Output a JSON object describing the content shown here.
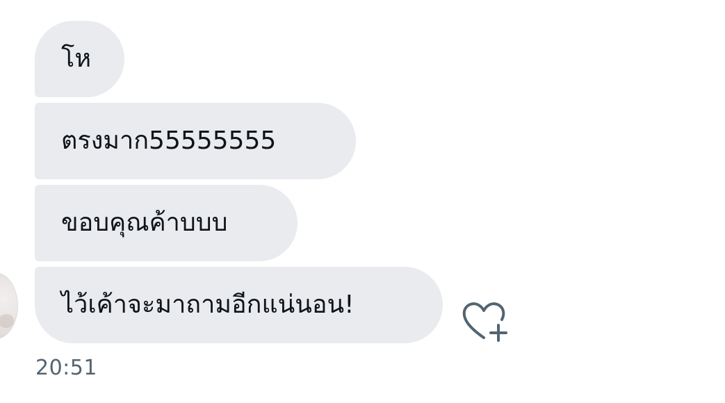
{
  "conversation": {
    "messages": [
      {
        "text": "โห"
      },
      {
        "text": "ตรงมาก55555555"
      },
      {
        "text": "ขอบคุณค้าบบบ"
      },
      {
        "text": "ไว้เค้าจะมาถามอีกแน่นอน!"
      }
    ],
    "timestamp": "20:51",
    "reaction_icon": "heart-plus-icon",
    "bubble_color": "#e9ebef",
    "text_color": "#0f1419",
    "meta_color": "#536471"
  }
}
